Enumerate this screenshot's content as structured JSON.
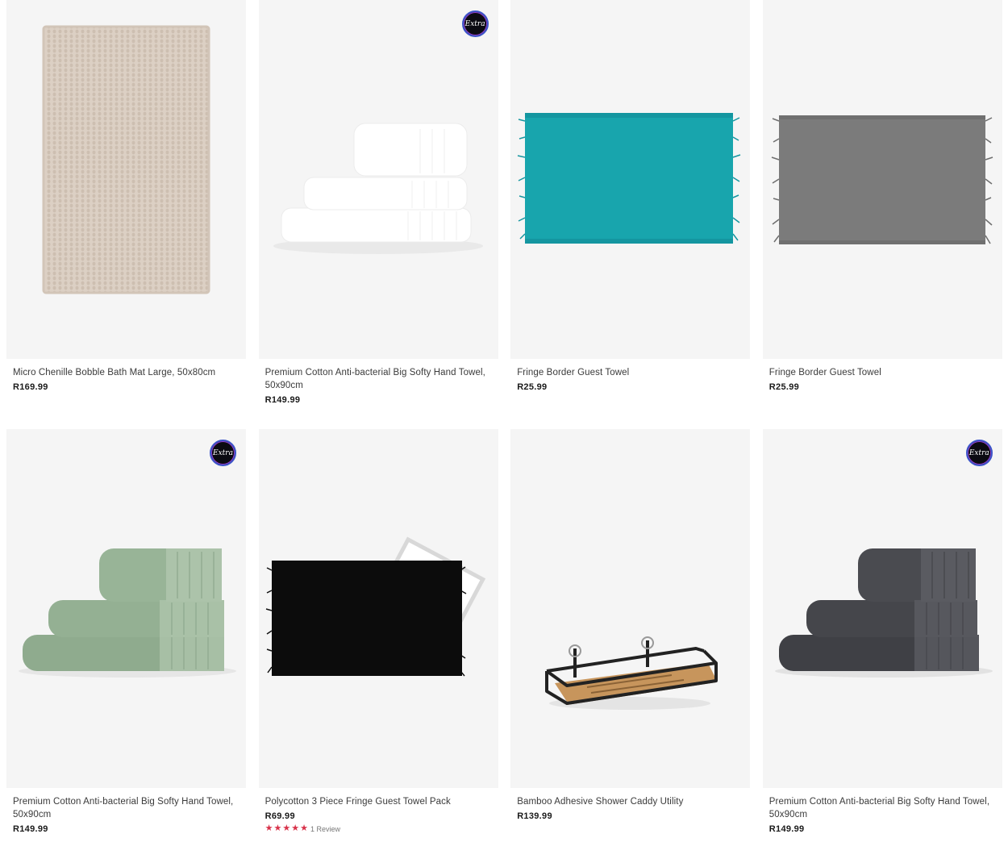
{
  "products": [
    {
      "title": "Micro Chenille Bobble Bath Mat Large, 50x80cm",
      "price": "R169.99",
      "image_icon": "beige-bath-mat-image",
      "badge": false
    },
    {
      "title": "Premium Cotton Anti-bacterial Big Softy Hand Towel, 50x90cm",
      "price": "R149.99",
      "image_icon": "white-towel-stack-image",
      "badge": true,
      "badge_text": "Extra"
    },
    {
      "title": "Fringe Border Guest Towel",
      "price": "R25.99",
      "image_icon": "teal-fringe-towel-image",
      "badge": false
    },
    {
      "title": "Fringe Border Guest Towel",
      "price": "R25.99",
      "image_icon": "grey-fringe-towel-image",
      "badge": false
    },
    {
      "title": "Premium Cotton Anti-bacterial Big Softy Hand Towel, 50x90cm",
      "price": "R149.99",
      "image_icon": "sage-towel-stack-image",
      "badge": true,
      "badge_text": "Extra"
    },
    {
      "title": "Polycotton 3 Piece Fringe Guest Towel Pack",
      "price": "R69.99",
      "image_icon": "black-towel-pack-image",
      "badge": false,
      "rating": 5,
      "review_text": "1 Review"
    },
    {
      "title": "Bamboo Adhesive Shower Caddy Utility",
      "price": "R139.99",
      "image_icon": "shower-caddy-image",
      "badge": false
    },
    {
      "title": "Premium Cotton Anti-bacterial Big Softy Hand Towel, 50x90cm",
      "price": "R149.99",
      "image_icon": "charcoal-towel-stack-image",
      "badge": true,
      "badge_text": "Extra"
    }
  ],
  "colors": {
    "star": "#d8324a",
    "card_bg": "#f5f5f5",
    "teal": "#18a5ad",
    "grey": "#7b7b7b",
    "sage": "#8fab8e",
    "charcoal": "#4a4b50"
  }
}
